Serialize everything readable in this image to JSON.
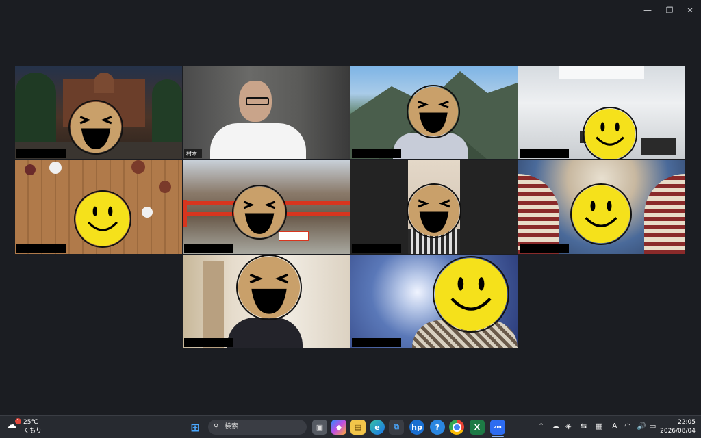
{
  "window": {
    "minimize_icon": "minimize-icon",
    "restore_icon": "restore-icon",
    "close_icon": "close-icon"
  },
  "participants": [
    {
      "name": "",
      "scene": "tokyo-station-night",
      "face": "laughing"
    },
    {
      "name": "村木",
      "scene": "webcam-bald-man",
      "face": "none",
      "active": true
    },
    {
      "name": "",
      "scene": "mountains",
      "face": "laughing"
    },
    {
      "name": "",
      "scene": "white-room",
      "face": "smiley"
    },
    {
      "name": "",
      "scene": "tanabata-decorations",
      "face": "smiley"
    },
    {
      "name": "",
      "scene": "red-bridge",
      "face": "laughing"
    },
    {
      "name": "",
      "scene": "plain-wall",
      "face": "laughing"
    },
    {
      "name": "",
      "scene": "mosque-ceiling",
      "face": "smiley"
    },
    {
      "name": "",
      "scene": "room-interior",
      "face": "laughing"
    },
    {
      "name": "",
      "scene": "blue-sky",
      "face": "smiley"
    }
  ],
  "taskbar": {
    "weather": {
      "temp": "25℃",
      "condition": "くもり",
      "badge": "1"
    },
    "search_placeholder": "検索",
    "clock_time": "22:05",
    "clock_date": "2026/08/04",
    "ime": "A"
  },
  "colors": {
    "active_border": "#2fd65a",
    "background": "#1b1d22",
    "smiley_yellow": "#f5e11b",
    "laugh_tan": "#c9a06a"
  }
}
